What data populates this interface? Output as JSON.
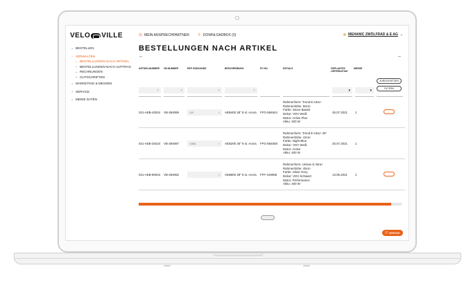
{
  "brand": {
    "logo_left": "VELO",
    "logo_right": "VILLE",
    "accent": "#e8631a"
  },
  "topnav": {
    "contact_label": "MEIN ANSPRECHPARTNER",
    "downloads_label": "DOWNLOADBOX (0)",
    "account_name": "MEHANIC ZWÖLFRAD & E AG"
  },
  "sidebar": {
    "items": [
      {
        "label": "BESTELLEN",
        "active": false
      },
      {
        "label": "VERWALTEN",
        "active": true
      },
      {
        "label": "BESTELLUNGEN NACH ARTIKEL",
        "active": true,
        "sub": true
      },
      {
        "label": "BESTELLUNGEN NACH AUFTRAG",
        "sub": true
      },
      {
        "label": "RECHNUNGEN",
        "sub": true
      },
      {
        "label": "GUTSCHRIFTEN",
        "sub": true
      },
      {
        "label": "MARKETING & MESSEN",
        "active": false
      },
      {
        "label": "SERVICE",
        "active": false
      },
      {
        "label": "MEINE DATEN",
        "active": false
      }
    ]
  },
  "page": {
    "title": "BESTELLUNGEN NACH ARTIKEL"
  },
  "table": {
    "columns": [
      "ARTIKELNUMMER",
      "VB-NUMMER",
      "REF. ENDKUNDE",
      "BESCHREIBUNG",
      "PO NO",
      "DETAILS",
      "GEPLANTES LIEFERDATUM",
      "MENGE"
    ],
    "reset_label": "ZURÜCKSETZEN",
    "filter_label": "FILTERN",
    "rows": [
      {
        "artikel": "021-AEB-40024",
        "vb": "VB-294089",
        "ref": "109",
        "beschreibung": "AEB400 28\" 8 st. Acera",
        "po": "FFG-584624",
        "details": [
          "Rahmenform: Trend E intra+",
          "Rahmenhöhe: 50cm",
          "Farbe: Stone Basalt",
          "Dekor: VDV Weiß",
          "Motor: Active Plus",
          "Akku: 400 W"
        ],
        "datum": "25.07.2021",
        "menge": "1"
      },
      {
        "artikel": "021-AEB-20424",
        "vb": "VB-294087",
        "ref": "10883",
        "beschreibung": "AEB200 26\" 8 st. Acera",
        "po": "FFG-584608",
        "details": [
          "Rahmenform: Trend E intra+ 26\"",
          "Rahmenhöhe: 42cm",
          "Farbe: Night Blue",
          "Dekor: VDV Weiß",
          "Motor: Active",
          "Akku: 400 W"
        ],
        "datum": "25.07.2021",
        "menge": "1"
      },
      {
        "artikel": "021-AEB-80024",
        "vb": "VB-294082",
        "ref": "",
        "beschreibung": "AEB800 28\" 8 st. Acera",
        "po": "FFF-419095",
        "details": [
          "Rahmenform: Unisex E intra+",
          "Rahmenhöhe: 45cm",
          "Farbe: Silver Grey",
          "Dekor: VDV Schwarz",
          "Motor: Performance",
          "Akku: 400 W"
        ],
        "datum": "13.06.2021",
        "menge": "1"
      }
    ]
  },
  "scroll_progress": 0.96,
  "service_label": "SERVICE"
}
